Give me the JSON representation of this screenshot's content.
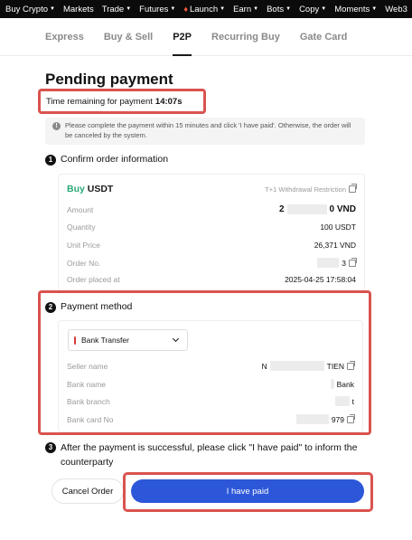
{
  "topnav": {
    "items": [
      {
        "label": "Buy Crypto",
        "dropdown": true
      },
      {
        "label": "Markets",
        "dropdown": false
      },
      {
        "label": "Trade",
        "dropdown": true
      },
      {
        "label": "Futures",
        "dropdown": true
      },
      {
        "label": "Launch",
        "dropdown": true,
        "icon": "flame-icon"
      },
      {
        "label": "Earn",
        "dropdown": true
      },
      {
        "label": "Bots",
        "dropdown": true
      },
      {
        "label": "Copy",
        "dropdown": true
      },
      {
        "label": "Moments",
        "dropdown": true
      },
      {
        "label": "Web3",
        "dropdown": false
      }
    ]
  },
  "subtabs": [
    {
      "label": "Express",
      "active": false
    },
    {
      "label": "Buy & Sell",
      "active": false
    },
    {
      "label": "P2P",
      "active": true
    },
    {
      "label": "Recurring Buy",
      "active": false
    },
    {
      "label": "Gate Card",
      "active": false
    }
  ],
  "page": {
    "title": "Pending payment",
    "timer_label": "Time remaining for payment",
    "timer_value": "14:07s",
    "notice": "Please complete the payment within 15 minutes and click 'I have paid'. Otherwise, the order will be canceled by the system."
  },
  "step1": {
    "number": "1",
    "title": "Confirm order information",
    "side": "Buy",
    "asset": "USDT",
    "restriction": "T+1 Withdrawal Restriction",
    "rows": [
      {
        "label": "Amount",
        "value_prefix": "2",
        "value_suffix": "0 VND"
      },
      {
        "label": "Quantity",
        "value": "100 USDT"
      },
      {
        "label": "Unit Price",
        "value": "26,371 VND"
      },
      {
        "label": "Order No.",
        "value_suffix": "3"
      },
      {
        "label": "Order placed at",
        "value": "2025-04-25 17:58:04"
      }
    ]
  },
  "step2": {
    "number": "2",
    "title": "Payment method",
    "method": "Bank Transfer",
    "rows": [
      {
        "label": "Seller name",
        "value_prefix": "N",
        "value_suffix": "TIEN"
      },
      {
        "label": "Bank name",
        "value_suffix": "Bank"
      },
      {
        "label": "Bank branch",
        "value_suffix": "t"
      },
      {
        "label": "Bank card No",
        "value_suffix": "979"
      }
    ]
  },
  "step3": {
    "number": "3",
    "text": "After the payment is successful, please click \"I have paid\" to inform the counterparty"
  },
  "actions": {
    "cancel_label": "Cancel Order",
    "paid_label": "I have paid"
  },
  "colors": {
    "accent_blue": "#2d57d9",
    "buy_green": "#2aa876",
    "highlight_red": "#d9534f"
  }
}
